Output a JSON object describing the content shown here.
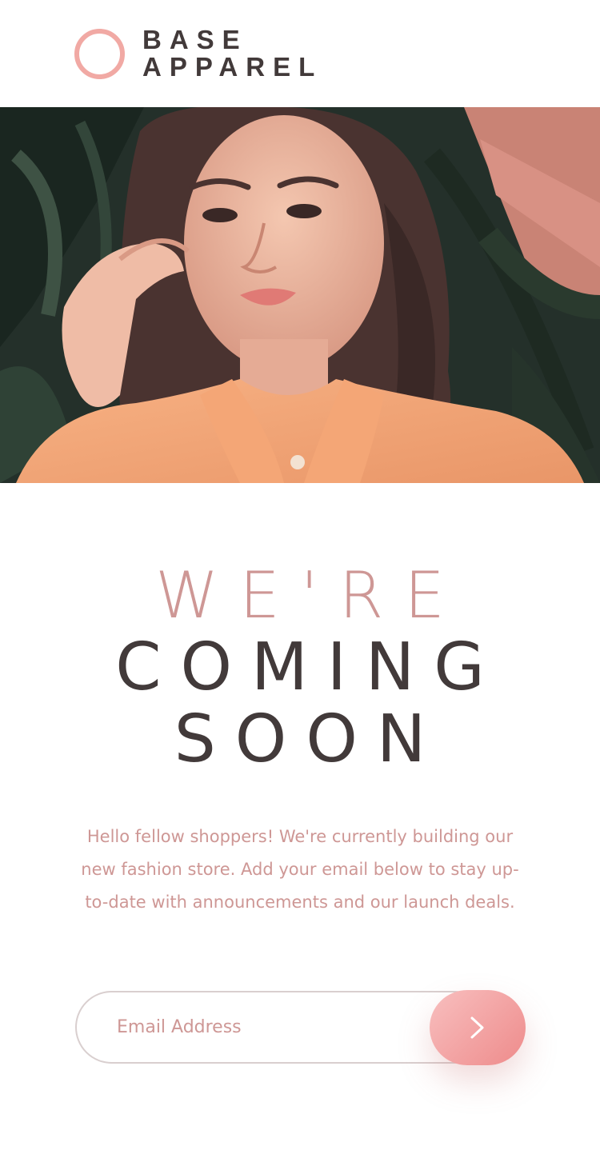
{
  "brand": {
    "line1": "BASE",
    "line2": "APPAREL",
    "logo_icon": "ring-logo-icon",
    "accent_color": "#f1a9a4"
  },
  "hero": {
    "image": "woman-portrait-photo"
  },
  "headline": {
    "light": "WE'RE",
    "dark_line1": "COMING",
    "dark_line2": "SOON"
  },
  "intro": {
    "text": "Hello fellow shoppers! We're currently building our new fashion store. Add your email below to stay up-to-date with announcements and our launch deals."
  },
  "form": {
    "email_placeholder": "Email Address",
    "email_value": "",
    "submit_icon": "chevron-right-icon"
  },
  "colors": {
    "text_dark": "#423a3a",
    "text_pink": "#ce9795",
    "button_gradient_start": "#f8bfbf",
    "button_gradient_end": "#ee8b8b"
  }
}
